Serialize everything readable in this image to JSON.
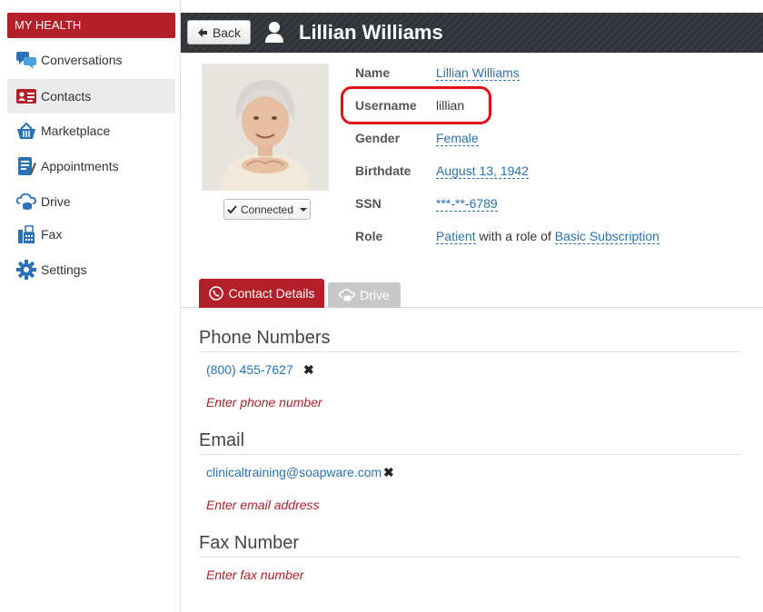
{
  "sidebar": {
    "header": "MY HEALTH",
    "items": [
      {
        "label": "Conversations",
        "icon": "conversations-icon"
      },
      {
        "label": "Contacts",
        "icon": "contacts-icon",
        "active": true
      },
      {
        "label": "Marketplace",
        "icon": "basket-icon"
      },
      {
        "label": "Appointments",
        "icon": "appointments-icon"
      },
      {
        "label": "Drive",
        "icon": "drive-icon"
      },
      {
        "label": "Fax",
        "icon": "fax-icon"
      },
      {
        "label": "Settings",
        "icon": "gear-icon"
      }
    ]
  },
  "header": {
    "back_label": "Back",
    "title": "Lillian Williams"
  },
  "profile": {
    "connected_label": "Connected",
    "fields": {
      "name_label": "Name",
      "name": "Lillian Williams",
      "username_label": "Username",
      "username": "lillian",
      "gender_label": "Gender",
      "gender": "Female",
      "birthdate_label": "Birthdate",
      "birthdate": "August 13, 1942",
      "ssn_label": "SSN",
      "ssn": "***-**-6789",
      "role_label": "Role",
      "role": "Patient",
      "role_mid": "with a role of",
      "subscription": "Basic Subscription"
    }
  },
  "tabs": {
    "contact_details": "Contact Details",
    "drive": "Drive"
  },
  "sections": {
    "phone": {
      "title": "Phone Numbers",
      "entry": "(800) 455-7627",
      "placeholder": "Enter phone number"
    },
    "email": {
      "title": "Email",
      "entry": "clinicaltraining@soapware.com",
      "placeholder": "Enter email address"
    },
    "fax": {
      "title": "Fax Number",
      "placeholder": "Enter fax number"
    }
  },
  "colors": {
    "accent": "#b3202a",
    "link": "#2a72b5",
    "highlight": "#e0101a"
  }
}
